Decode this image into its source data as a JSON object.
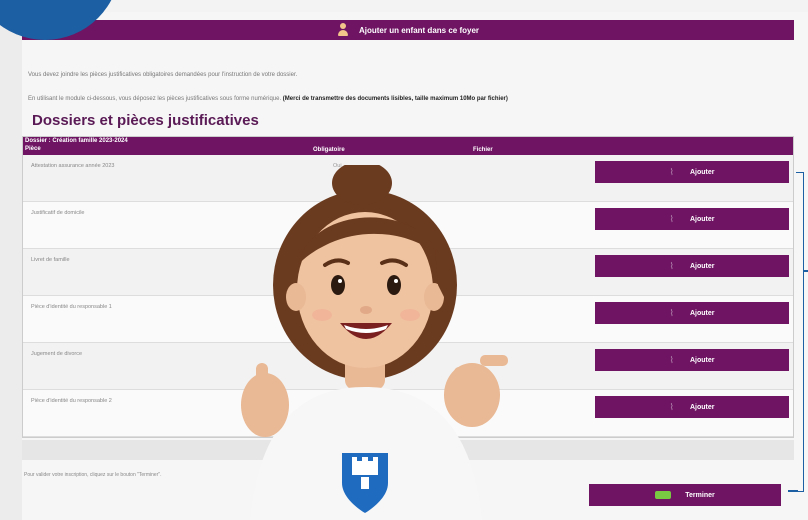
{
  "header": {
    "add_child_label": "Ajouter un enfant dans ce foyer"
  },
  "intro": {
    "line1": "Vous devez joindre les pièces justificatives obligatoires demandées pour l'instruction de votre dossier.",
    "line2": "En utilisant le module ci-dessous, vous déposez les pièces justificatives sous forme numérique.",
    "line2_bold": "(Merci de transmettre des documents lisibles, taille maximum 10Mo par fichier)"
  },
  "section_title": "Dossiers et pièces justificatives",
  "table": {
    "dossier_label": "Dossier : Création famille 2023-2024",
    "columns": {
      "piece": "Pièce",
      "obligatoire": "Obligatoire",
      "fichier": "Fichier"
    },
    "rows": [
      {
        "piece": "Attestation assurance année 2023",
        "obligatoire": "Oui",
        "button": "Ajouter"
      },
      {
        "piece": "Justificatif de domicile",
        "obligatoire": "",
        "button": "Ajouter"
      },
      {
        "piece": "Livret de famille",
        "obligatoire": "",
        "button": "Ajouter"
      },
      {
        "piece": "Pièce d'identité du responsable 1",
        "obligatoire": "",
        "button": "Ajouter"
      },
      {
        "piece": "Jugement de divorce",
        "obligatoire": "",
        "button": "Ajouter"
      },
      {
        "piece": "Pièce d'identité du responsable 2",
        "obligatoire": "",
        "button": "Ajouter"
      }
    ]
  },
  "footer": {
    "note": "Pour valider votre inscription, cliquez sur le bouton \"Terminer\".",
    "finish_label": "Terminer"
  },
  "colors": {
    "brand": "#6e1463",
    "accent_blue": "#1d5fa3",
    "finish_arrow": "#7ac943"
  },
  "icons": {
    "header": "user-icon",
    "row_button": "paperclip-icon",
    "finish": "arrow-icon",
    "shirt_badge": "castle-shield-icon"
  }
}
